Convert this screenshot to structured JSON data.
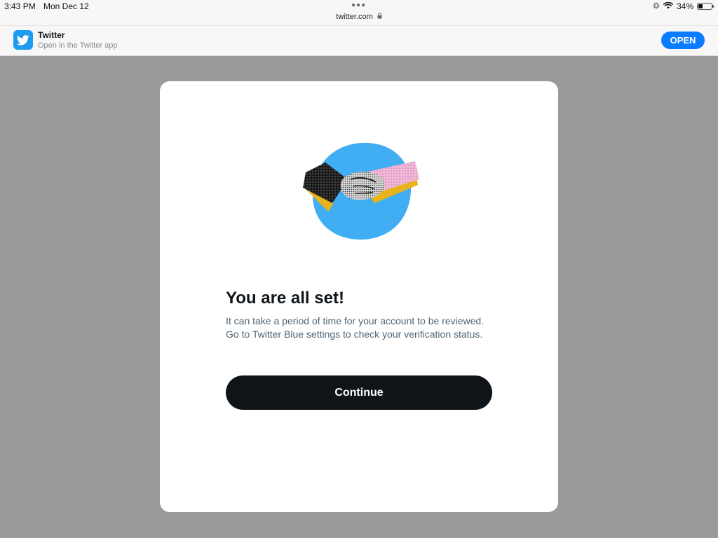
{
  "status_bar": {
    "time": "3:43 PM",
    "date": "Mon Dec 12",
    "url": "twitter.com",
    "battery_percent": "34%",
    "battery_level": 0.34
  },
  "app_banner": {
    "app_name": "Twitter",
    "subtitle": "Open in the Twitter app",
    "open_label": "OPEN",
    "icon": "twitter-bird-icon"
  },
  "modal": {
    "title": "You are all set!",
    "body": "It can take a period of time for your account to be reviewed. Go to Twitter Blue settings to check your verification status.",
    "continue_label": "Continue",
    "illustration": "handshake-illustration"
  },
  "colors": {
    "twitter_blue": "#1d9bf0",
    "open_button": "#0a7cff",
    "button_dark": "#0f1419",
    "overlay": "#9a9a9a"
  }
}
